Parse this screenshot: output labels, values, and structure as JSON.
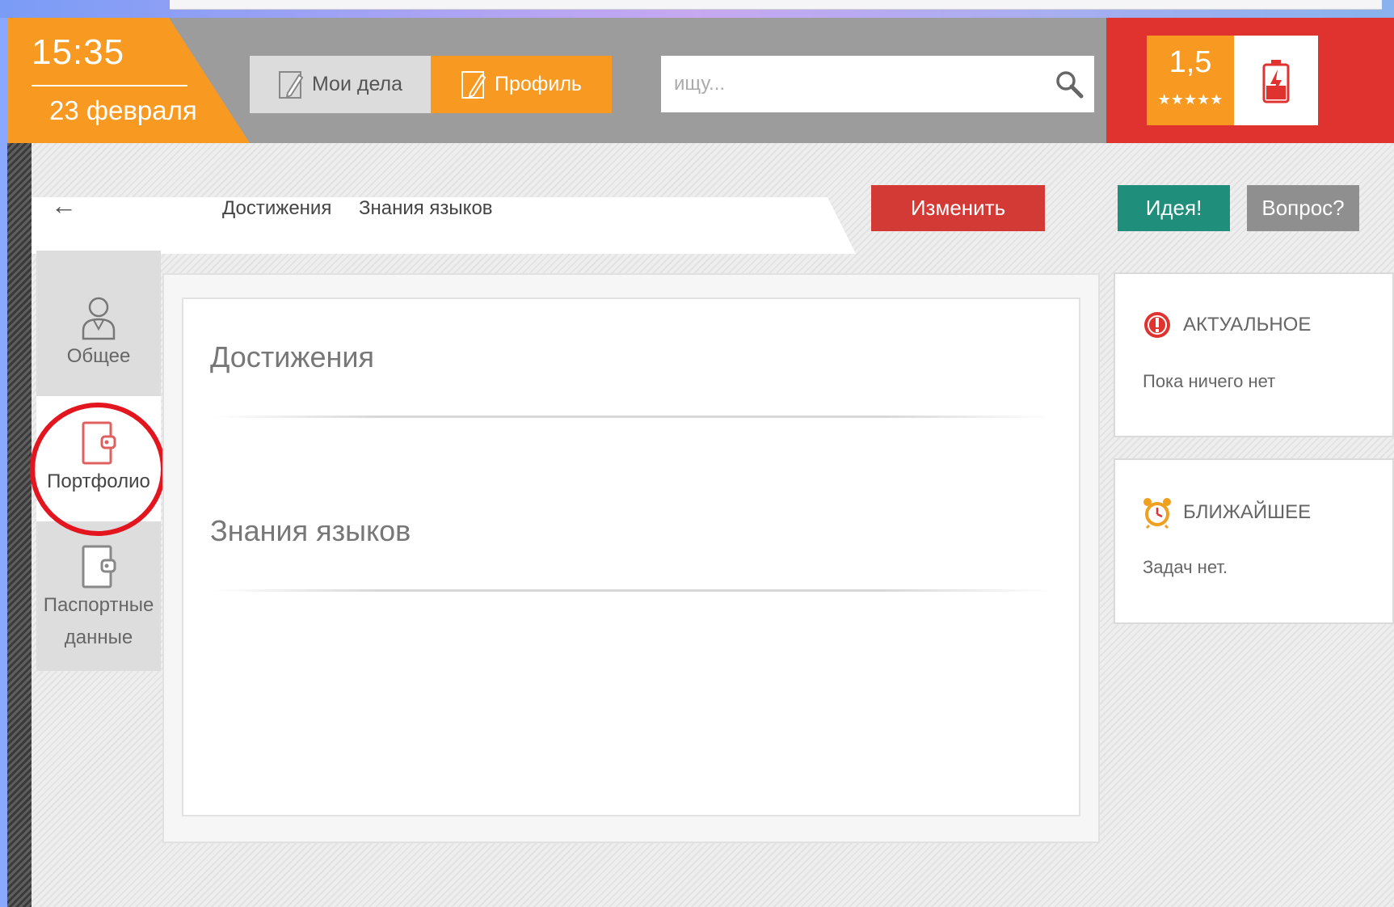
{
  "header": {
    "time": "15:35",
    "date": "23 февраля",
    "tabs": [
      {
        "label": "Мои дела",
        "icon": "pencil-icon"
      },
      {
        "label": "Профиль",
        "icon": "pencil-icon"
      }
    ],
    "search": {
      "placeholder": "ищу...",
      "icon": "search-icon"
    },
    "rating": {
      "score": "1,5",
      "stars": "★★★★★"
    },
    "battery_icon": "battery-low-icon"
  },
  "breadcrumb": {
    "back_icon": "back-arrow-icon",
    "back_glyph": "←",
    "items": [
      "Достижения",
      "Знания языков"
    ]
  },
  "actions": {
    "edit": "Изменить",
    "idea": "Идея!",
    "question": "Вопрос?"
  },
  "sidebar": {
    "items": [
      {
        "label": "Общее",
        "icon": "user-icon"
      },
      {
        "label": "Портфолио",
        "icon": "portfolio-icon",
        "active": true
      },
      {
        "label": "Паспортные данные",
        "line1": "Паспортные",
        "line2": "данные",
        "icon": "passport-icon"
      }
    ]
  },
  "main": {
    "sections": [
      {
        "title": "Достижения"
      },
      {
        "title": "Знания языков"
      }
    ]
  },
  "right": {
    "actual": {
      "title": "АКТУАЛЬНОЕ",
      "text": "Пока ничего нет",
      "icon": "alert-icon"
    },
    "nearest": {
      "title": "БЛИЖАЙШЕЕ",
      "text": "Задач нет.",
      "icon": "alarm-clock-icon"
    }
  },
  "colors": {
    "orange": "#f89a21",
    "red": "#d33a35",
    "teal": "#1f8f7c",
    "gray": "#8f8f8f",
    "highlight": "#e3151f"
  }
}
